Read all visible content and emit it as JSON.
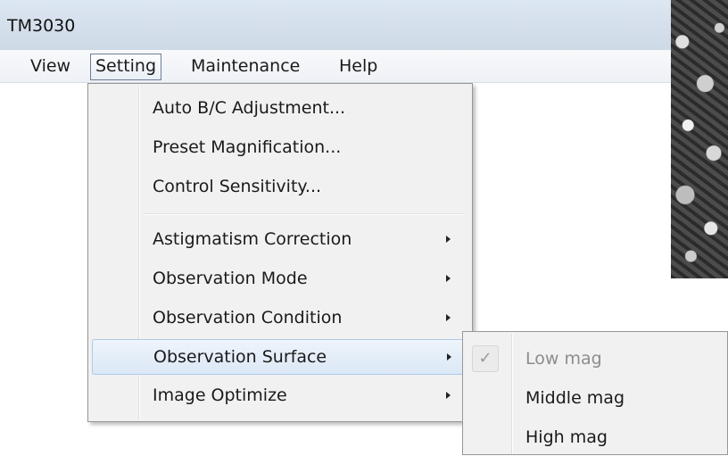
{
  "window": {
    "title": "TM3030"
  },
  "menubar": {
    "items": [
      {
        "label": "View",
        "open": false
      },
      {
        "label": "Setting",
        "open": true
      },
      {
        "label": "Maintenance",
        "open": false
      },
      {
        "label": "Help",
        "open": false
      }
    ]
  },
  "setting_menu": {
    "group1": [
      {
        "label": "Auto B/C Adjustment..."
      },
      {
        "label": "Preset Magnification..."
      },
      {
        "label": "Control Sensitivity..."
      }
    ],
    "group2": [
      {
        "label": "Astigmatism Correction",
        "has_submenu": true
      },
      {
        "label": "Observation Mode",
        "has_submenu": true
      },
      {
        "label": "Observation Condition",
        "has_submenu": true
      },
      {
        "label": "Observation Surface",
        "has_submenu": true,
        "highlighted": true
      },
      {
        "label": "Image Optimize",
        "has_submenu": true
      }
    ]
  },
  "surface_submenu": {
    "items": [
      {
        "label": "Low mag",
        "checked": true,
        "disabled": true,
        "check_glyph": "✓"
      },
      {
        "label": "Middle mag",
        "checked": false,
        "disabled": false
      },
      {
        "label": "High mag",
        "checked": false,
        "disabled": false
      }
    ]
  },
  "colors": {
    "titlebar": "#d5e0ec",
    "menu_bg": "#f1f1f1",
    "highlight": "#dbe8f6"
  }
}
